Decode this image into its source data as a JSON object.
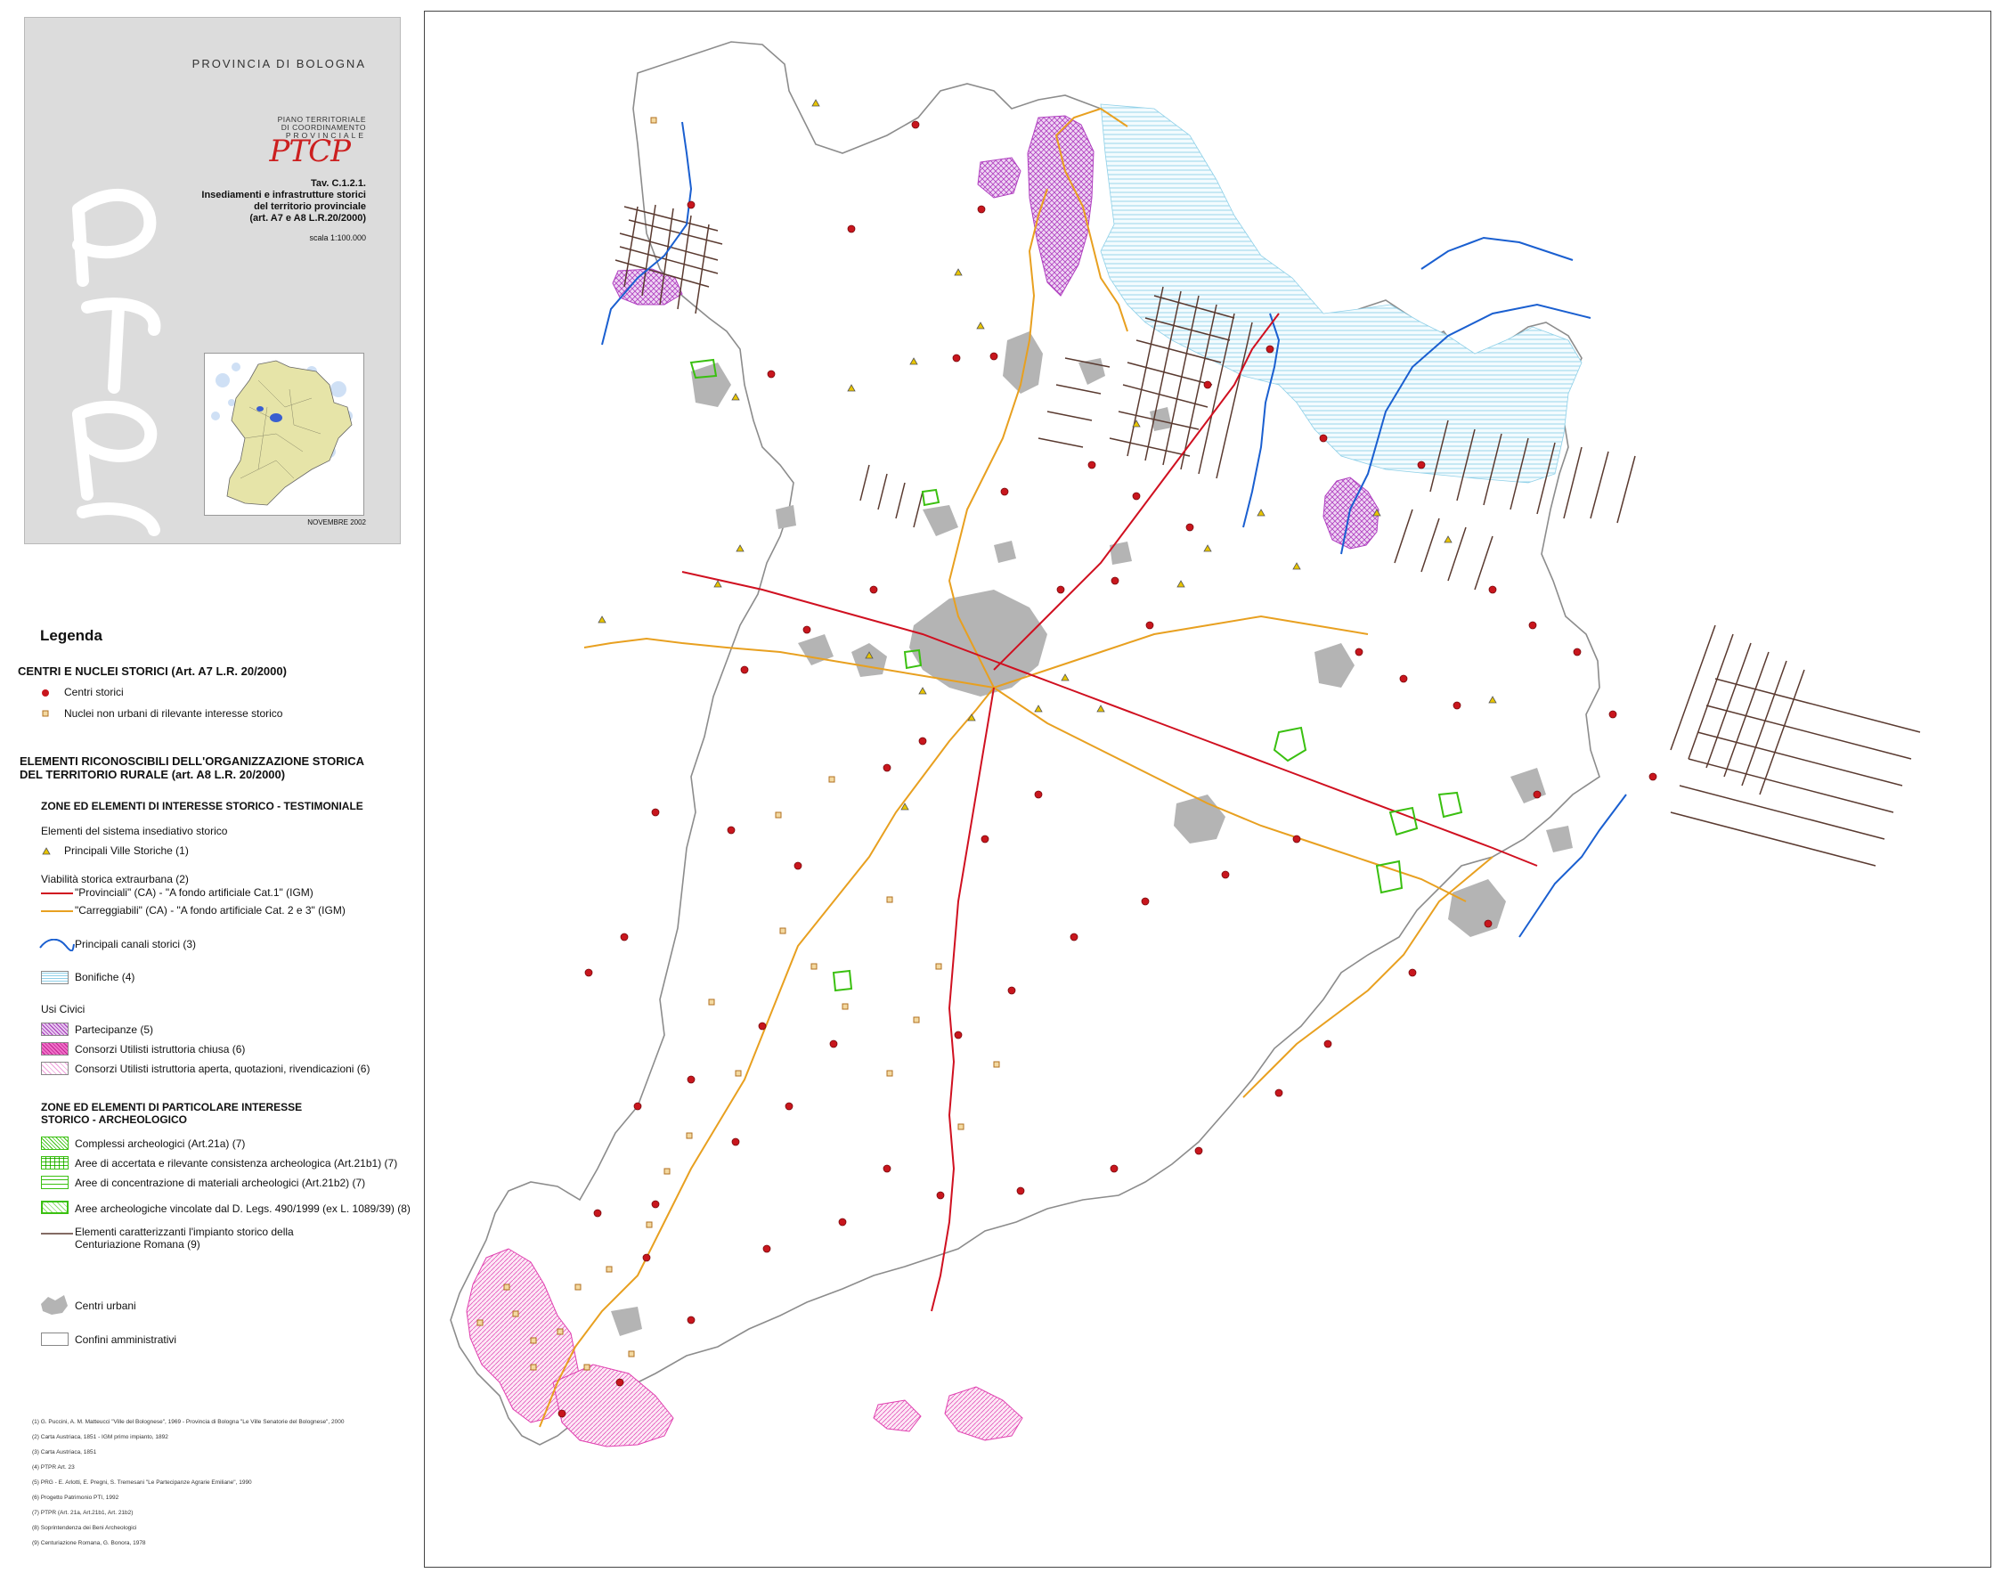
{
  "cover": {
    "provincia": "PROVINCIA DI BOLOGNA",
    "plan_line1": "PIANO TERRITORIALE",
    "plan_line2": "DI COORDINAMENTO",
    "plan_line3": "PROVINCIALE",
    "brand": "PTCP",
    "tav_line1": "Tav. C.1.2.1.",
    "tav_line2": "Insediamenti e infrastrutture storici",
    "tav_line3": "del territorio provinciale",
    "tav_line4": "(art. A7 e A8 L.R.20/2000)",
    "scale": "scala 1:100.000",
    "date": "NOVEMBRE 2002"
  },
  "legend": {
    "title": "Legenda",
    "section1_title": "CENTRI E NUCLEI STORICI (Art. A7 L.R. 20/2000)",
    "centri_storici": "Centri storici",
    "nuclei": "Nuclei non urbani di rilevante interesse storico",
    "section2_line1": "ELEMENTI RICONOSCIBILI DELL'ORGANIZZAZIONE STORICA",
    "section2_line2": "DEL TERRITORIO RURALE (art. A8 L.R. 20/2000)",
    "zone1_title": "ZONE ED ELEMENTI DI INTERESSE STORICO - TESTIMONIALE",
    "sistema_insediativo": "Elementi del sistema insediativo storico",
    "ville": "Principali Ville Storiche   (1)",
    "viabilita": "Viabilità storica extraurbana   (2)",
    "provinciali": "\"Provinciali\" (CA) - \"A fondo artificiale Cat.1\" (IGM)",
    "carreggiabili": "\"Carreggiabili\" (CA) - \"A fondo artificiale Cat. 2 e 3\" (IGM)",
    "canali": "Principali canali storici   (3)",
    "bonifiche": "Bonifiche   (4)",
    "usi_civici": "Usi Civici",
    "partecipanze": "Partecipanze   (5)",
    "consorzi_chiusa": "Consorzi Utilisti istruttoria chiusa   (6)",
    "consorzi_aperta": "Consorzi Utilisti istruttoria aperta, quotazioni, rivendicazioni   (6)",
    "zone2_line1": "ZONE ED ELEMENTI DI PARTICOLARE INTERESSE",
    "zone2_line2": "STORICO - ARCHEOLOGICO",
    "complessi": "Complessi archeologici (Art.21a)   (7)",
    "aree_accertata": "Aree di accertata e rilevante consistenza archeologica (Art.21b1)  (7)",
    "aree_concentrazione": "Aree di concentrazione di materiali archeologici (Art.21b2)   (7)",
    "aree_vincolate": "Aree archeologiche vincolate dal D. Legs. 490/1999 (ex L. 1089/39)   (8)",
    "centuriazione_line1": "Elementi caratterizzanti l'impianto storico della",
    "centuriazione_line2": "Centuriazione Romana   (9)",
    "centri_urbani": "Centri urbani",
    "confini": "Confini amministrativi"
  },
  "references": [
    "(1) G. Puccini, A. M. Matteucci \"Ville del Bolognese\", 1969 - Provincia di Bologna \"Le Ville Senatorie del Bolognese\", 2000",
    "(2) Carta Austriaca, 1851 - IGM primo impianto, 1892",
    "(3) Carta Austriaca, 1851",
    "(4) PTPR Art. 23",
    "(5) PRG - E. Arlotti, E. Pregni, S. Tremesani \"Le Partecipanze Agrarie Emiliane\", 1990",
    "(6) Progetto Patrimonio PTI, 1992",
    "(7) PTPR (Art. 21a, Art.21b1, Art. 21b2)",
    "(8) Soprintendenza dei Beni Archeologici",
    "(9) Centuriazione Romana, G. Bonora, 1978"
  ],
  "colors": {
    "centri_storici": "#c8161d",
    "nuclei": "#e0a040",
    "ville": "#e8c400",
    "provinciali": "#d01020",
    "carreggiabili": "#e8a020",
    "canali": "#1a5fd0",
    "bonifiche": "#8fd0e8",
    "partecipanze": "#b040c0",
    "consorzi": "#e040b0",
    "archeo": "#3ac010",
    "centuriazione": "#5a3a30",
    "centri_urbani": "#b4b4b4",
    "confini": "#888888"
  }
}
